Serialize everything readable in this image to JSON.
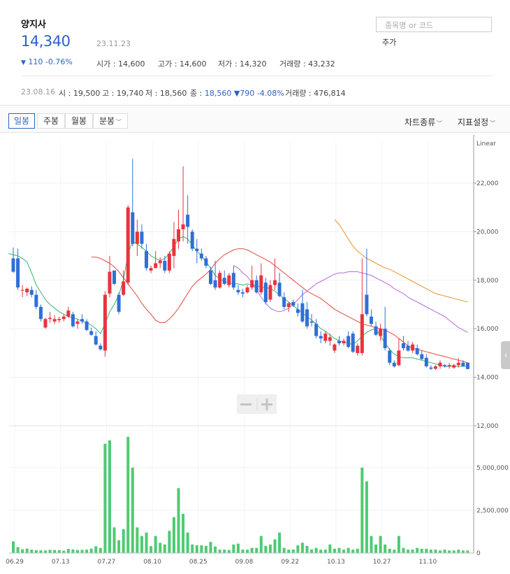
{
  "stock": {
    "name": "양지사",
    "price": "14,340",
    "date": "23.11.23",
    "change": "110",
    "change_pct": "-0.76%",
    "open_label": "시가",
    "open": "14,600",
    "high_label": "고가",
    "high": "14,600",
    "low_label": "저가",
    "low": "14,320",
    "volume_label": "거래량",
    "volume": "43,232"
  },
  "search": {
    "placeholder": "종목명 or 코드",
    "add_label": "추가"
  },
  "history": {
    "date": "23.08.16",
    "open_label": "시",
    "open": "19,500",
    "high_label": "고",
    "high": "19,740",
    "low_label": "저",
    "low": "18,560",
    "close_label": "종",
    "close": "18,560",
    "change": "790",
    "change_pct": "-4.08%",
    "volume_label": "거래량",
    "volume": "476,814"
  },
  "tabs": {
    "daily": "일봉",
    "weekly": "주봉",
    "monthly": "월봉",
    "minute": "분봉"
  },
  "right_tabs": {
    "chart_type": "차트종류",
    "indicators": "지표설정"
  },
  "colors": {
    "up": "#e8343d",
    "down": "#2f6fd8",
    "volume": "#4ecb71",
    "ma5": "#3cb371",
    "ma20": "#e34a3f",
    "ma60": "#b36be0",
    "ma120": "#e8942e",
    "accent": "#2b63c8"
  },
  "icons": {
    "down_triangle": "down-triangle-icon",
    "zoom_out": "minus-icon",
    "zoom_in": "plus-icon",
    "side_handle": "chevron-left-icon"
  },
  "chart_data": {
    "type": "candlestick",
    "scale_label": "Linear",
    "x_ticks": [
      "06.29",
      "07.13",
      "07.27",
      "08.10",
      "08.25",
      "09.08",
      "09.22",
      "10.13",
      "10.27",
      "11.10"
    ],
    "price_ticks": [
      "12,000",
      "14,000",
      "16,000",
      "18,000",
      "20,000",
      "22,000"
    ],
    "price_ylim": [
      12000,
      23700
    ],
    "volume_ticks": [
      "0",
      "2,500,000",
      "5,000,000"
    ],
    "volume_ylim": [
      0,
      7000000
    ],
    "candles": [
      {
        "o": 18900,
        "h": 19350,
        "l": 18300,
        "c": 18350
      },
      {
        "o": 18900,
        "h": 19300,
        "l": 17600,
        "c": 17700
      },
      {
        "o": 17600,
        "h": 17800,
        "l": 17300,
        "c": 17600
      },
      {
        "o": 17500,
        "h": 17700,
        "l": 17350,
        "c": 17650
      },
      {
        "o": 17600,
        "h": 17750,
        "l": 17300,
        "c": 17400
      },
      {
        "o": 17400,
        "h": 17600,
        "l": 16800,
        "c": 16900
      },
      {
        "o": 16900,
        "h": 17000,
        "l": 16300,
        "c": 16400
      },
      {
        "o": 16050,
        "h": 16450,
        "l": 16000,
        "c": 16400
      },
      {
        "o": 16400,
        "h": 16700,
        "l": 16250,
        "c": 16450
      },
      {
        "o": 16300,
        "h": 16550,
        "l": 16200,
        "c": 16400
      },
      {
        "o": 16350,
        "h": 16500,
        "l": 16250,
        "c": 16400
      },
      {
        "o": 16400,
        "h": 16600,
        "l": 16300,
        "c": 16500
      },
      {
        "o": 16500,
        "h": 16900,
        "l": 16450,
        "c": 16750
      },
      {
        "o": 16600,
        "h": 16700,
        "l": 16050,
        "c": 16100
      },
      {
        "o": 16200,
        "h": 16400,
        "l": 16000,
        "c": 16300
      },
      {
        "o": 16400,
        "h": 16600,
        "l": 16200,
        "c": 16300
      },
      {
        "o": 16300,
        "h": 16400,
        "l": 15900,
        "c": 15950
      },
      {
        "o": 15900,
        "h": 16050,
        "l": 15700,
        "c": 15750
      },
      {
        "o": 15700,
        "h": 15900,
        "l": 15300,
        "c": 15350
      },
      {
        "o": 15300,
        "h": 15400,
        "l": 15100,
        "c": 15150
      },
      {
        "o": 15100,
        "h": 17550,
        "l": 14850,
        "c": 17400
      },
      {
        "o": 17450,
        "h": 19000,
        "l": 17300,
        "c": 18350
      },
      {
        "o": 18400,
        "h": 18400,
        "l": 17800,
        "c": 17850
      },
      {
        "o": 17400,
        "h": 17500,
        "l": 16600,
        "c": 16700
      },
      {
        "o": 17400,
        "h": 18400,
        "l": 17350,
        "c": 17950
      },
      {
        "o": 17900,
        "h": 21100,
        "l": 17800,
        "c": 21000
      },
      {
        "o": 20800,
        "h": 23000,
        "l": 19400,
        "c": 19500
      },
      {
        "o": 19500,
        "h": 20500,
        "l": 19000,
        "c": 20000
      },
      {
        "o": 20000,
        "h": 20300,
        "l": 19300,
        "c": 19500
      },
      {
        "o": 19200,
        "h": 19500,
        "l": 18400,
        "c": 18500
      },
      {
        "o": 18400,
        "h": 18600,
        "l": 18300,
        "c": 18500
      },
      {
        "o": 18500,
        "h": 19200,
        "l": 18500,
        "c": 18700
      },
      {
        "o": 18700,
        "h": 18950,
        "l": 18500,
        "c": 18800
      },
      {
        "o": 18800,
        "h": 19000,
        "l": 18300,
        "c": 18400
      },
      {
        "o": 18400,
        "h": 19200,
        "l": 18300,
        "c": 19100
      },
      {
        "o": 19000,
        "h": 20400,
        "l": 18500,
        "c": 19700
      },
      {
        "o": 19600,
        "h": 20900,
        "l": 19300,
        "c": 20100
      },
      {
        "o": 20100,
        "h": 22700,
        "l": 19600,
        "c": 20300
      },
      {
        "o": 20700,
        "h": 21500,
        "l": 19500,
        "c": 20200
      },
      {
        "o": 20000,
        "h": 20100,
        "l": 19200,
        "c": 19300
      },
      {
        "o": 19300,
        "h": 19700,
        "l": 18700,
        "c": 19200
      },
      {
        "o": 19100,
        "h": 19300,
        "l": 18800,
        "c": 18900
      },
      {
        "o": 18900,
        "h": 19000,
        "l": 18500,
        "c": 18600
      },
      {
        "o": 18400,
        "h": 18550,
        "l": 17800,
        "c": 17850
      },
      {
        "o": 18000,
        "h": 18800,
        "l": 17600,
        "c": 17700
      },
      {
        "o": 17700,
        "h": 18400,
        "l": 17650,
        "c": 18300
      },
      {
        "o": 18100,
        "h": 18400,
        "l": 17800,
        "c": 17850
      },
      {
        "o": 17800,
        "h": 18300,
        "l": 17700,
        "c": 18200
      },
      {
        "o": 18300,
        "h": 18600,
        "l": 17600,
        "c": 17700
      },
      {
        "o": 17600,
        "h": 17800,
        "l": 17400,
        "c": 17500
      },
      {
        "o": 17500,
        "h": 17650,
        "l": 17300,
        "c": 17450
      },
      {
        "o": 17500,
        "h": 17800,
        "l": 17450,
        "c": 17700
      },
      {
        "o": 17700,
        "h": 18600,
        "l": 17600,
        "c": 18000
      },
      {
        "o": 18000,
        "h": 18200,
        "l": 17450,
        "c": 17500
      },
      {
        "o": 17500,
        "h": 18700,
        "l": 17400,
        "c": 18200
      },
      {
        "o": 17900,
        "h": 18100,
        "l": 17000,
        "c": 17100
      },
      {
        "o": 17200,
        "h": 18000,
        "l": 17100,
        "c": 17800
      },
      {
        "o": 17800,
        "h": 18900,
        "l": 17600,
        "c": 18000
      },
      {
        "o": 17900,
        "h": 18300,
        "l": 17300,
        "c": 17350
      },
      {
        "o": 17300,
        "h": 17500,
        "l": 16800,
        "c": 16900
      },
      {
        "o": 16900,
        "h": 17100,
        "l": 16700,
        "c": 17050
      },
      {
        "o": 17100,
        "h": 17200,
        "l": 16900,
        "c": 16950
      },
      {
        "o": 16800,
        "h": 17050,
        "l": 16500,
        "c": 16650
      },
      {
        "o": 17050,
        "h": 17600,
        "l": 16250,
        "c": 16300
      },
      {
        "o": 16800,
        "h": 17100,
        "l": 16000,
        "c": 16100
      },
      {
        "o": 16300,
        "h": 16600,
        "l": 16100,
        "c": 16250
      },
      {
        "o": 16200,
        "h": 16400,
        "l": 15600,
        "c": 15700
      },
      {
        "o": 15700,
        "h": 15900,
        "l": 15400,
        "c": 15600
      },
      {
        "o": 15500,
        "h": 15900,
        "l": 15400,
        "c": 15800
      },
      {
        "o": 15500,
        "h": 15800,
        "l": 15300,
        "c": 15650
      },
      {
        "o": 15100,
        "h": 15400,
        "l": 15000,
        "c": 15350
      },
      {
        "o": 15500,
        "h": 15700,
        "l": 15300,
        "c": 15400
      },
      {
        "o": 15400,
        "h": 15600,
        "l": 15300,
        "c": 15500
      },
      {
        "o": 15700,
        "h": 15900,
        "l": 15200,
        "c": 15250
      },
      {
        "o": 15800,
        "h": 15900,
        "l": 15000,
        "c": 15050
      },
      {
        "o": 15000,
        "h": 15400,
        "l": 14900,
        "c": 15300
      },
      {
        "o": 15000,
        "h": 18900,
        "l": 14900,
        "c": 16600
      },
      {
        "o": 17400,
        "h": 19300,
        "l": 16500,
        "c": 16600
      },
      {
        "o": 16500,
        "h": 16800,
        "l": 16100,
        "c": 16200
      },
      {
        "o": 16100,
        "h": 16300,
        "l": 15700,
        "c": 15750
      },
      {
        "o": 15700,
        "h": 16200,
        "l": 15500,
        "c": 16000
      },
      {
        "o": 16000,
        "h": 16900,
        "l": 15100,
        "c": 15200
      },
      {
        "o": 15100,
        "h": 15200,
        "l": 14500,
        "c": 14600
      },
      {
        "o": 14600,
        "h": 14700,
        "l": 14400,
        "c": 14450
      },
      {
        "o": 14500,
        "h": 15600,
        "l": 14450,
        "c": 15100
      },
      {
        "o": 15400,
        "h": 15700,
        "l": 15100,
        "c": 15200
      },
      {
        "o": 15300,
        "h": 15500,
        "l": 15050,
        "c": 15100
      },
      {
        "o": 15100,
        "h": 15450,
        "l": 15000,
        "c": 15350
      },
      {
        "o": 15200,
        "h": 15350,
        "l": 14900,
        "c": 14950
      },
      {
        "o": 14950,
        "h": 15100,
        "l": 14700,
        "c": 14750
      },
      {
        "o": 14800,
        "h": 14950,
        "l": 14400,
        "c": 14450
      },
      {
        "o": 14400,
        "h": 14500,
        "l": 14300,
        "c": 14350
      },
      {
        "o": 14350,
        "h": 14500,
        "l": 14300,
        "c": 14450
      },
      {
        "o": 14450,
        "h": 14700,
        "l": 14350,
        "c": 14600
      },
      {
        "o": 14500,
        "h": 14550,
        "l": 14400,
        "c": 14450
      },
      {
        "o": 14450,
        "h": 14600,
        "l": 14350,
        "c": 14500
      },
      {
        "o": 14400,
        "h": 14550,
        "l": 14350,
        "c": 14500
      },
      {
        "o": 14500,
        "h": 14800,
        "l": 14400,
        "c": 14600
      },
      {
        "o": 14600,
        "h": 14700,
        "l": 14450,
        "c": 14450
      },
      {
        "o": 14600,
        "h": 14600,
        "l": 14320,
        "c": 14340
      }
    ],
    "volumes": [
      680000,
      350000,
      220000,
      260000,
      200000,
      170000,
      160000,
      150000,
      190000,
      180000,
      170000,
      140000,
      240000,
      210000,
      180000,
      190000,
      200000,
      260000,
      400000,
      300000,
      6400000,
      6600000,
      1500000,
      750000,
      1400000,
      6800000,
      5000000,
      1500000,
      1000000,
      1200000,
      400000,
      1000000,
      600000,
      500000,
      1300000,
      2100000,
      3800000,
      2300000,
      1200000,
      500000,
      450000,
      450000,
      420000,
      650000,
      380000,
      200000,
      200000,
      180000,
      500000,
      550000,
      200000,
      200000,
      300000,
      300000,
      1000000,
      420000,
      500000,
      800000,
      1200000,
      300000,
      200000,
      210000,
      450000,
      600000,
      420000,
      210000,
      300000,
      200000,
      200000,
      500000,
      250000,
      300000,
      200000,
      300000,
      200000,
      250000,
      5000000,
      4200000,
      1000000,
      500000,
      1000000,
      500000,
      250000,
      200000,
      1000000,
      300000,
      200000,
      200000,
      300000,
      250000,
      250000,
      200000,
      200000,
      150000,
      200000,
      150000,
      150000,
      200000,
      150000,
      150000,
      150000
    ],
    "moving_averages": [
      {
        "name": "MA5",
        "points": [
          [
            19100,
            19050,
            19000,
            18900,
            18750,
            18300,
            17800,
            17500,
            17200,
            17000,
            16850,
            16700,
            16600,
            16500,
            16450,
            16400,
            16300,
            16250,
            16150,
            16000,
            15800,
            16200,
            16700,
            17000,
            17400,
            18000,
            19100,
            19600,
            19500,
            19350,
            19200,
            19000,
            18900,
            18800,
            18900,
            19100,
            19400,
            19700,
            19800,
            19700,
            19450,
            19200,
            19000,
            18750,
            18500,
            18200,
            18050,
            17950,
            17900,
            17850,
            17850,
            17800,
            17850,
            17800,
            17800,
            17700,
            17700,
            17650,
            17550,
            17400,
            17250,
            17100,
            16950,
            16800,
            16650,
            16500,
            16350,
            16200,
            16000,
            15900,
            15750,
            15600,
            15500,
            15450,
            15400,
            15350,
            15500,
            15700,
            15850,
            15950,
            16000,
            15700,
            15400,
            15150,
            14950,
            14850,
            14800,
            14800,
            14800,
            14750,
            14700,
            14650,
            14600,
            14550,
            14500,
            14450,
            14450,
            14450,
            14450,
            14450,
            14450
          ]
        ]
      },
      {
        "name": "MA20",
        "points": [
          [
            18950,
            18950,
            18900,
            18800,
            18700,
            18550,
            18350,
            18100,
            17850,
            17600,
            17350,
            17050,
            16800,
            16600,
            16350,
            16250,
            16250,
            16400,
            16600,
            16850,
            17150,
            17450,
            17750,
            17950,
            18100,
            18250,
            18450,
            18700,
            18900,
            19050,
            19150,
            19250,
            19300,
            19300,
            19250,
            19150,
            19050,
            18950,
            18850,
            18750,
            18600,
            18450,
            18300,
            18150,
            18000,
            17850,
            17700,
            17550,
            17450,
            17350,
            17250,
            17100,
            16950,
            16800,
            16700,
            16600,
            16500,
            16400,
            16300,
            16200,
            16150,
            16100,
            16050,
            16000,
            15950,
            15850,
            15750,
            15600,
            15450,
            15300,
            15200,
            15150,
            15100,
            15050,
            15000,
            14950,
            14900,
            14850,
            14800,
            14750,
            14700,
            14650,
            14600
          ]
        ]
      },
      {
        "name": "MA60",
        "points": [
          [
            18600,
            18500,
            18300,
            18150,
            17900,
            17600,
            17300,
            17050,
            16850,
            16750,
            16700,
            16750,
            16850,
            17000,
            17200,
            17400,
            17550,
            17700,
            17850,
            17950,
            18050,
            18150,
            18250,
            18300,
            18300,
            18350,
            18350,
            18350,
            18300,
            18250,
            18200,
            18100,
            18000,
            17900,
            17800,
            17650,
            17550,
            17450,
            17300,
            17200,
            17100,
            17000,
            16900,
            16800,
            16700,
            16600,
            16500,
            16350,
            16200,
            16050,
            15950,
            15850
          ]
        ]
      },
      {
        "name": "MA120",
        "points": [
          [
            20500,
            20300,
            20000,
            19700,
            19400,
            19200,
            19050,
            18900,
            18800,
            18700,
            18600,
            18500,
            18450,
            18350,
            18250,
            18150,
            18050,
            17950,
            17850,
            17750,
            17650,
            17550,
            17450,
            17400,
            17350,
            17300,
            17250,
            17200,
            17150,
            17100
          ]
        ]
      }
    ]
  }
}
